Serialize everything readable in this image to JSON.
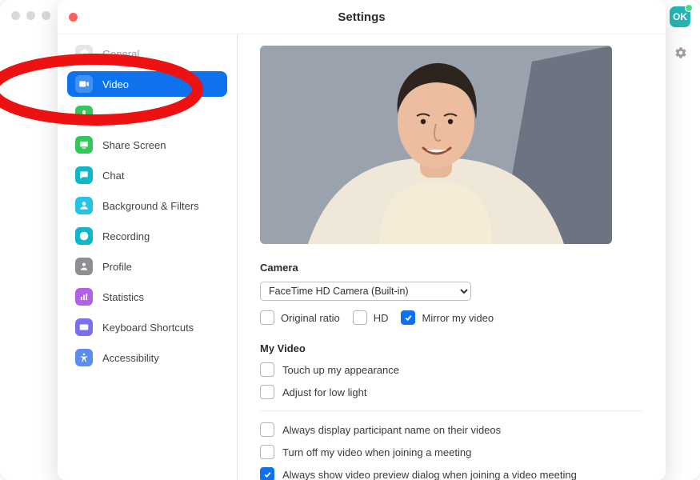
{
  "window_title": "Settings",
  "topbar": {
    "avatar_initials": "OK"
  },
  "sidebar": {
    "items": [
      {
        "id": "general",
        "label": "General",
        "color": "#cfd3d8",
        "icon": "gear"
      },
      {
        "id": "video",
        "label": "Video",
        "color": "#0E72ED",
        "icon": "video",
        "active": true
      },
      {
        "id": "audio",
        "label": "Audio",
        "color": "#34c759",
        "icon": "audio",
        "hidden_label": true
      },
      {
        "id": "share",
        "label": "Share Screen",
        "color": "#34c759",
        "icon": "share"
      },
      {
        "id": "chat",
        "label": "Chat",
        "color": "#0fb8c9",
        "icon": "chat"
      },
      {
        "id": "bg",
        "label": "Background & Filters",
        "color": "#25c3e6",
        "icon": "person"
      },
      {
        "id": "recording",
        "label": "Recording",
        "color": "#0fb8c9",
        "icon": "record"
      },
      {
        "id": "profile",
        "label": "Profile",
        "color": "#8e8e93",
        "icon": "profile"
      },
      {
        "id": "stats",
        "label": "Statistics",
        "color": "#b160e8",
        "icon": "stats"
      },
      {
        "id": "keys",
        "label": "Keyboard Shortcuts",
        "color": "#7a6ff0",
        "icon": "keyboard"
      },
      {
        "id": "a11y",
        "label": "Accessibility",
        "color": "#5b8def",
        "icon": "a11y"
      }
    ]
  },
  "content": {
    "section_camera": "Camera",
    "camera_select_value": "FaceTime HD Camera (Built-in)",
    "camera_opts": {
      "original_ratio": {
        "label": "Original ratio",
        "checked": false
      },
      "hd": {
        "label": "HD",
        "checked": false
      },
      "mirror": {
        "label": "Mirror my video",
        "checked": true
      }
    },
    "section_myvideo": "My Video",
    "myvideo_opts": [
      {
        "label": "Touch up my appearance",
        "checked": false
      },
      {
        "label": "Adjust for low light",
        "checked": false
      }
    ],
    "meeting_opts": [
      {
        "label": "Always display participant name on their videos",
        "checked": false
      },
      {
        "label": "Turn off my video when joining a meeting",
        "checked": false
      },
      {
        "label": "Always show video preview dialog when joining a video meeting",
        "checked": true
      }
    ]
  }
}
